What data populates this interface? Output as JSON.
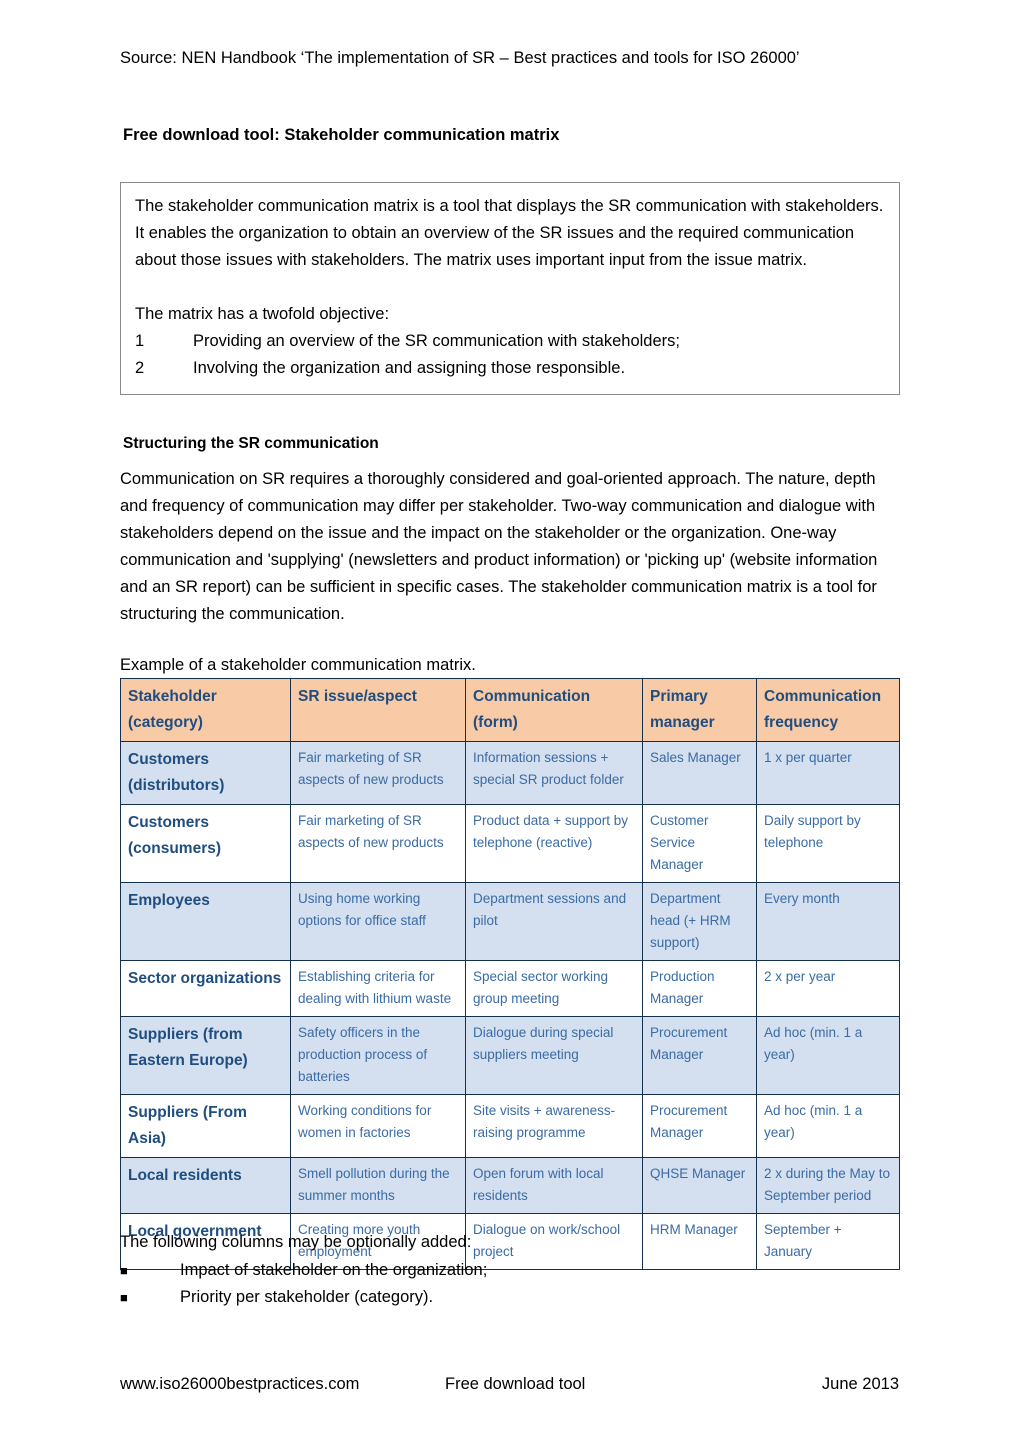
{
  "header": {
    "source": "Source: NEN Handbook ‘The implementation of SR – Best practices and tools for ISO 26000’"
  },
  "title": "Free download tool: Stakeholder communication matrix",
  "intro_box": {
    "paragraph": "The stakeholder communication matrix is a tool that displays the SR communication with stakeholders. It enables the organization to obtain an overview of the SR issues and the required communication about those issues with stakeholders. The matrix uses important input from the issue matrix.",
    "objective_lead": "The matrix has a twofold objective:",
    "objectives": [
      {
        "num": "1",
        "text": "Providing an overview of the SR communication with stakeholders;"
      },
      {
        "num": "2",
        "text": "Involving the organization and assigning those responsible."
      }
    ]
  },
  "section": {
    "heading": "Structuring the SR communication",
    "body": "Communication on SR requires a thoroughly considered and goal-oriented approach. The nature, depth and frequency of communication may differ per stakeholder. Two-way communication and dialogue with stakeholders depend on the issue and the impact on the stakeholder or the organization. One-way communication and 'supplying' (newsletters and product information) or 'picking up' (website information and an SR report) can be sufficient in specific cases. The stakeholder communication matrix is a tool for structuring the communication.",
    "example_caption": "Example of a stakeholder communication matrix."
  },
  "table": {
    "header_bg": "#F8CBA6",
    "shaded_row_bg": "#D4E0EF",
    "header_text_color": "#1F4D80",
    "body_text_color": "#3A6BA5",
    "border_color": "#13304D",
    "columns": [
      "Stakeholder (category)",
      "SR issue/aspect",
      "Communication (form)",
      "Primary manager",
      "Communication frequency"
    ],
    "columns_lines": [
      [
        "Stakeholder",
        "(category)"
      ],
      [
        "SR issue/aspect",
        ""
      ],
      [
        "Communication",
        "(form)"
      ],
      [
        "Primary",
        "manager"
      ],
      [
        "Communication",
        "frequency"
      ]
    ],
    "rows": [
      {
        "shaded": true,
        "category": "Customers (distributors)",
        "issue": "Fair marketing of SR aspects of new products",
        "form": "Information sessions + special SR product folder",
        "manager": "Sales Manager",
        "frequency": "1 x per quarter"
      },
      {
        "shaded": false,
        "category": "Customers (consumers)",
        "issue": "Fair marketing of SR aspects of new products",
        "form": "Product data + support by telephone (reactive)",
        "manager": "Customer Service Manager",
        "frequency": "Daily support by telephone"
      },
      {
        "shaded": true,
        "category": "Employees",
        "issue": "Using home working options for office staff",
        "form": "Department sessions and pilot",
        "manager": "Department head (+ HRM support)",
        "frequency": "Every month"
      },
      {
        "shaded": false,
        "category": "Sector organizations",
        "issue": "Establishing criteria for dealing with lithium waste",
        "form": "Special sector working group meeting",
        "manager": "Production Manager",
        "frequency": "2 x per year"
      },
      {
        "shaded": true,
        "category": "Suppliers (from Eastern Europe)",
        "issue": "Safety officers in the production process of batteries",
        "form": "Dialogue during special suppliers meeting",
        "manager": "Procurement Manager",
        "frequency": "Ad hoc (min. 1 a year)"
      },
      {
        "shaded": false,
        "category": "Suppliers (From Asia)",
        "issue": "Working conditions for women in factories",
        "form": "Site visits + awareness-raising programme",
        "manager": "Procurement Manager",
        "frequency": "Ad hoc (min. 1 a year)"
      },
      {
        "shaded": true,
        "category": "Local residents",
        "issue": "Smell pollution during the summer months",
        "form": "Open forum with local residents",
        "manager": "QHSE Manager",
        "frequency": "2 x during the May to September period"
      },
      {
        "shaded": false,
        "category": "Local government",
        "issue": "Creating more youth employment",
        "form": "Dialogue on work/school project",
        "manager": "HRM Manager",
        "frequency": "September + January"
      }
    ]
  },
  "optional": {
    "intro": "The following columns may be optionally added:",
    "bullet_glyph": "■",
    "items": [
      "Impact of stakeholder on the organization;",
      "Priority per stakeholder (category)."
    ]
  },
  "footer": {
    "site": "www.iso26000bestpractices.com",
    "middle": "Free download tool",
    "date": "June 2013"
  }
}
